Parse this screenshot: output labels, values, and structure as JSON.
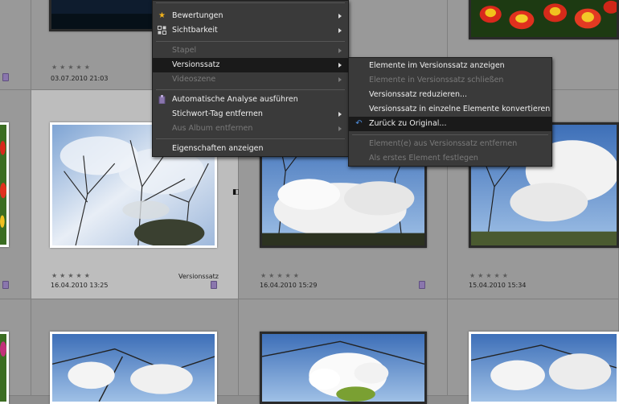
{
  "colors": {
    "menu_bg": "#3a3a3a",
    "highlight": "#1a1a1a",
    "cell_bg": "#999999",
    "selected_cell_bg": "#bdbdbd",
    "version_icon": "#8a76ad"
  },
  "thumbnails": [
    {
      "stars": "★★★★★",
      "date": "03.07.2010 21:03",
      "has_version_icon": false
    },
    {
      "stars": "★★★★★",
      "date": "16.04.2010 13:25",
      "version_label": "Versionssatz",
      "has_version_icon": true
    },
    {
      "stars": "★★★★★",
      "date": "16.04.2010 15:29",
      "has_version_icon": true
    },
    {
      "stars": "★★★★★",
      "date": "15.04.2010 15:34"
    }
  ],
  "context_menu": {
    "items": [
      {
        "label": "Bewertungen",
        "icon": "star-icon",
        "submenu": true,
        "enabled": true
      },
      {
        "label": "Sichtbarkeit",
        "icon": "visibility-icon",
        "submenu": true,
        "enabled": true
      },
      {
        "label": "Stapel",
        "submenu": true,
        "enabled": false
      },
      {
        "label": "Versionssatz",
        "submenu": true,
        "enabled": true,
        "highlighted": true
      },
      {
        "label": "Videoszene",
        "submenu": true,
        "enabled": false
      },
      {
        "label": "Automatische Analyse ausführen",
        "icon": "analysis-icon",
        "enabled": true
      },
      {
        "label": "Stichwort-Tag entfernen",
        "submenu": true,
        "enabled": true
      },
      {
        "label": "Aus Album entfernen",
        "submenu": true,
        "enabled": false
      },
      {
        "label": "Eigenschaften anzeigen",
        "enabled": true
      }
    ]
  },
  "submenu": {
    "items": [
      {
        "label": "Elemente im Versionssatz anzeigen",
        "enabled": true
      },
      {
        "label": "Elemente in Versionssatz schließen",
        "enabled": false
      },
      {
        "label": "Versionssatz reduzieren...",
        "enabled": true
      },
      {
        "label": "Versionssatz in einzelne Elemente konvertieren",
        "enabled": true
      },
      {
        "label": "Zurück zu Original...",
        "icon": "revert-arrow-icon",
        "enabled": true,
        "highlighted": true
      },
      {
        "label": "Element(e) aus Versionssatz entfernen",
        "enabled": false
      },
      {
        "label": "Als erstes Element festlegen",
        "enabled": false
      }
    ]
  }
}
